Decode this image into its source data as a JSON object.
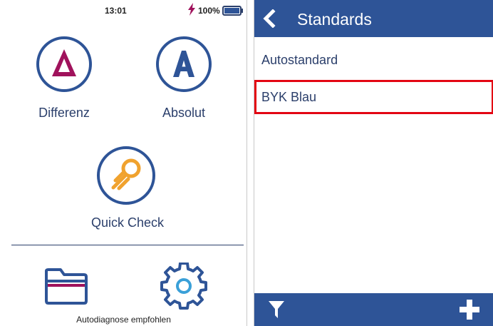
{
  "status": {
    "time": "13:01",
    "battery_pct": "100%",
    "battery_level": 1.0
  },
  "home": {
    "differenz": {
      "label": "Differenz",
      "symbol": "Δ"
    },
    "absolut": {
      "label": "Absolut",
      "symbol": "A"
    },
    "quick_check": {
      "label": "Quick Check"
    },
    "autodiag_text": "Autodiagnose empfohlen"
  },
  "standards": {
    "title": "Standards",
    "items": [
      {
        "label": "Autostandard",
        "selected": false
      },
      {
        "label": "BYK Blau",
        "selected": true
      }
    ]
  },
  "colors": {
    "brand_blue": "#2e5497",
    "differenz_magenta": "#a0125c",
    "quick_check_orange": "#f0a22e",
    "selection_red": "#e30613"
  }
}
